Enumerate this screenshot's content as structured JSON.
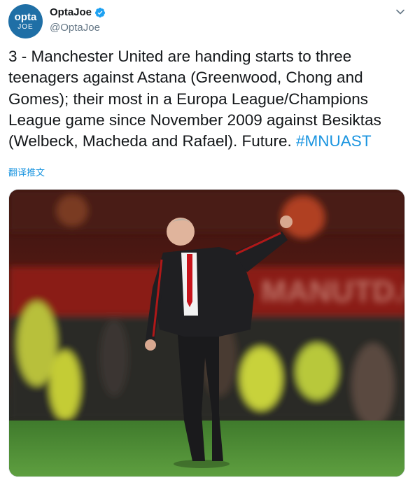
{
  "user": {
    "avatar_line1": "opta",
    "avatar_line2": "JOE",
    "display_name": "OptaJoe",
    "handle": "@OptaJoe",
    "verified": true
  },
  "tweet": {
    "text": "3 - Manchester United are handing starts to three teenagers against Astana (Greenwood, Chong and Gomes); their most in a Europa League/Champions League game since November 2009 against Besiktas (Welbeck, Macheda and Rafael). Future. ",
    "hashtag": "#MNUAST",
    "translate_label": "翻译推文"
  },
  "media": {
    "banner_text": "MANUTD.C"
  },
  "colors": {
    "link": "#1b95e0",
    "avatar_bg": "#1f6fa6",
    "verified": "#1da1f2"
  },
  "icons": [
    "verified-badge-icon",
    "chevron-down-icon"
  ]
}
